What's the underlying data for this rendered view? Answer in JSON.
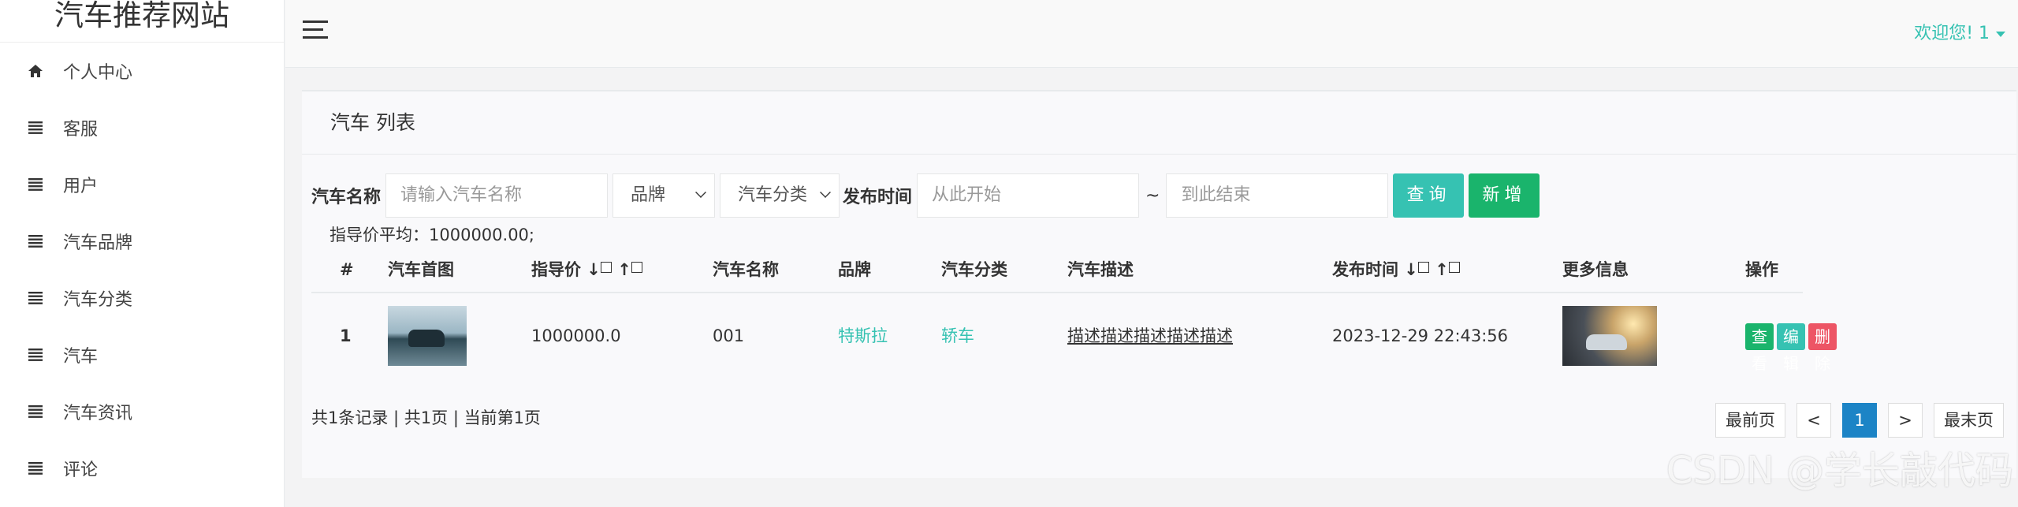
{
  "brand": "汽车推荐网站",
  "sidebar": {
    "items": [
      {
        "label": "个人中心",
        "icon": "home-icon"
      },
      {
        "label": "客服",
        "icon": "list-icon"
      },
      {
        "label": "用户",
        "icon": "list-icon"
      },
      {
        "label": "汽车品牌",
        "icon": "list-icon"
      },
      {
        "label": "汽车分类",
        "icon": "list-icon"
      },
      {
        "label": "汽车",
        "icon": "list-icon"
      },
      {
        "label": "汽车资讯",
        "icon": "list-icon"
      },
      {
        "label": "评论",
        "icon": "list-icon"
      }
    ]
  },
  "topbar": {
    "welcome": "欢迎您! 1",
    "accent_color": "#36c2b2"
  },
  "panel": {
    "title": "汽车 列表"
  },
  "filters": {
    "name_label": "汽车名称",
    "name_placeholder": "请输入汽车名称",
    "brand_select": "品牌",
    "category_select": "汽车分类",
    "time_label": "发布时间",
    "start_placeholder": "从此开始",
    "range_sep": "~",
    "end_placeholder": "到此结束",
    "query_button": "查询",
    "add_button": "新增"
  },
  "avg_text": "指导价平均：1000000.00;",
  "table": {
    "headers": [
      "#",
      "汽车首图",
      "指导价 ↓",
      "↑",
      "汽车名称",
      "品牌",
      "汽车分类",
      "汽车描述",
      "发布时间 ↓",
      "↑",
      "更多信息",
      "操作"
    ],
    "rows": [
      {
        "index": "1",
        "price": "1000000.0",
        "name": "001",
        "brand": "特斯拉",
        "category": "轿车",
        "description": "描述描述描述描述描述",
        "time": "2023-12-29 22:43:56",
        "actions": [
          "查看",
          "编辑",
          "删除"
        ]
      }
    ]
  },
  "summary": "共1条记录 | 共1页 | 当前第1页",
  "pager": {
    "first": "最前页",
    "prev": "<",
    "current": "1",
    "next": ">",
    "last": "最末页"
  },
  "watermark": "CSDN @学长敲代码"
}
